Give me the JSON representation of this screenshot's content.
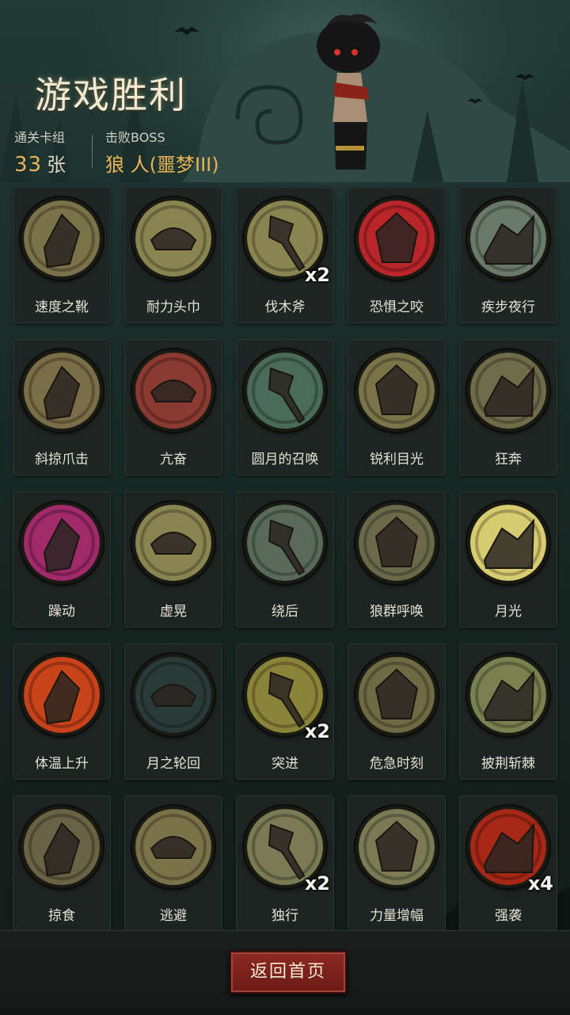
{
  "header": {
    "title": "游戏胜利",
    "deck_label": "通关卡组",
    "deck_count": "33",
    "deck_unit": "张",
    "boss_label": "击败BOSS",
    "boss_name": "狼 人(噩梦III)"
  },
  "cards": [
    {
      "name": "速度之靴",
      "icon": "boot-icon",
      "bg": "#7a7248",
      "count": ""
    },
    {
      "name": "耐力头巾",
      "icon": "bandana-icon",
      "bg": "#8a8450",
      "count": ""
    },
    {
      "name": "伐木斧",
      "icon": "axe-icon",
      "bg": "#8a8450",
      "count": "x2"
    },
    {
      "name": "恐惧之咬",
      "icon": "fear-bite-icon",
      "bg": "#b8262a",
      "count": ""
    },
    {
      "name": "疾步夜行",
      "icon": "night-stride-icon",
      "bg": "#6a7a6a",
      "count": ""
    },
    {
      "name": "斜掠爪击",
      "icon": "claw-slash-icon",
      "bg": "#7a6e48",
      "count": ""
    },
    {
      "name": "亢奋",
      "icon": "frenzy-icon",
      "bg": "#8a3a30",
      "count": ""
    },
    {
      "name": "圆月的召唤",
      "icon": "full-moon-call-icon",
      "bg": "#4a6a5a",
      "count": ""
    },
    {
      "name": "锐利目光",
      "icon": "sharp-gaze-icon",
      "bg": "#7a7448",
      "count": ""
    },
    {
      "name": "狂奔",
      "icon": "dash-icon",
      "bg": "#6e6c4a",
      "count": ""
    },
    {
      "name": "躁动",
      "icon": "restless-icon",
      "bg": "#a02a6a",
      "count": ""
    },
    {
      "name": "虚晃",
      "icon": "feint-icon",
      "bg": "#8a8450",
      "count": ""
    },
    {
      "name": "绕后",
      "icon": "flank-icon",
      "bg": "#5a6a5a",
      "count": ""
    },
    {
      "name": "狼群呼唤",
      "icon": "wolf-howl-icon",
      "bg": "#6a6a4a",
      "count": ""
    },
    {
      "name": "月光",
      "icon": "moonlight-icon",
      "bg": "#d8cc70",
      "count": ""
    },
    {
      "name": "体温上升",
      "icon": "fever-icon",
      "bg": "#c8421a",
      "count": ""
    },
    {
      "name": "月之轮回",
      "icon": "moon-phases-icon",
      "bg": "#2a3a38",
      "count": ""
    },
    {
      "name": "突进",
      "icon": "lunge-icon",
      "bg": "#8a8438",
      "count": "x2"
    },
    {
      "name": "危急时刻",
      "icon": "critical-moment-icon",
      "bg": "#6e6a44",
      "count": ""
    },
    {
      "name": "披荆斩棘",
      "icon": "blade-icon",
      "bg": "#7a8050",
      "count": ""
    },
    {
      "name": "掠食",
      "icon": "predator-icon",
      "bg": "#6a6244",
      "count": ""
    },
    {
      "name": "逃避",
      "icon": "escape-icon",
      "bg": "#7a7248",
      "count": ""
    },
    {
      "name": "独行",
      "icon": "lone-walk-icon",
      "bg": "#7a7a54",
      "count": "x2"
    },
    {
      "name": "力量增幅",
      "icon": "power-boost-icon",
      "bg": "#7a7a54",
      "count": ""
    },
    {
      "name": "强袭",
      "icon": "assault-icon",
      "bg": "#a82818",
      "count": "x4"
    }
  ],
  "footer": {
    "return_label": "返回首页"
  }
}
